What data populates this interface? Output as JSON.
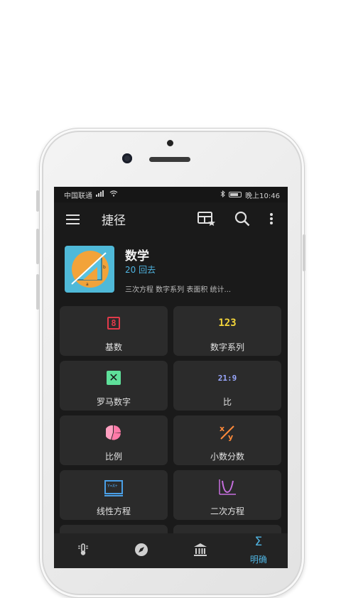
{
  "status_bar": {
    "carrier": "中国联通",
    "time": "晚上10:46"
  },
  "app_bar": {
    "title": "捷径"
  },
  "hero": {
    "title": "数学",
    "subtitle": "20 回去",
    "description": "三次方程 数字系列 表面积 统计..."
  },
  "tiles": [
    {
      "label": "基数",
      "icon_text": "8",
      "icon": "digit-8-icon"
    },
    {
      "label": "数字系列",
      "icon_text": "123",
      "icon": "number-series-icon"
    },
    {
      "label": "罗马数字",
      "icon_text": "✕",
      "icon": "roman-x-icon"
    },
    {
      "label": "比",
      "icon_text": "21:9",
      "icon": "ratio-icon"
    },
    {
      "label": "比例",
      "icon_text": "",
      "icon": "pie-chart-icon"
    },
    {
      "label": "小数分数",
      "icon_text": "",
      "icon": "fraction-icon"
    },
    {
      "label": "线性方程",
      "icon_text": "Y=X+",
      "icon": "linear-equation-icon"
    },
    {
      "label": "二次方程",
      "icon_text": "",
      "icon": "quadratic-graph-icon"
    }
  ],
  "bottom_nav": {
    "active_label": "明确",
    "active_symbol": "Σ"
  },
  "colors": {
    "accent": "#4fb3e0",
    "background": "#1a1a1a",
    "card": "#2b2b2b",
    "hero_bg": "#4fb9d8",
    "hero_circle": "#f2a33a"
  }
}
